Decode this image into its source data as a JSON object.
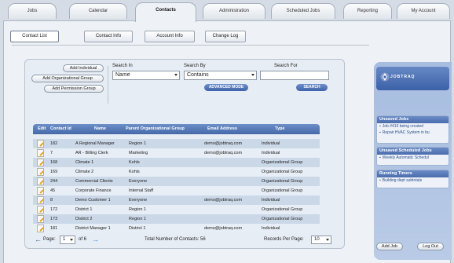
{
  "top_nav": {
    "tabs": [
      {
        "label": "Jobs",
        "active": false
      },
      {
        "label": "Calendar",
        "active": false
      },
      {
        "label": "Contacts",
        "active": true
      },
      {
        "label": "Administration",
        "active": false
      },
      {
        "label": "Scheduled Jobs",
        "active": false
      },
      {
        "label": "Reporting",
        "active": false
      },
      {
        "label": "My Account",
        "active": false
      }
    ]
  },
  "sub_tabs": [
    {
      "label": "Contact List",
      "active": true
    },
    {
      "label": "Contact Info",
      "active": false
    },
    {
      "label": "Account Info",
      "active": false
    },
    {
      "label": "Change Log",
      "active": false
    }
  ],
  "actions": {
    "add_individual": "Add Individual",
    "add_organizational_group": "Add Organizational Group",
    "add_permission_group": "Add Permission Group"
  },
  "search": {
    "search_in_label": "Search In",
    "search_in_value": "Name",
    "search_by_label": "Search By",
    "search_by_value": "Contains",
    "search_for_label": "Search For",
    "search_for_value": "",
    "advanced_mode_label": "ADVANCED MODE",
    "search_button_label": "SEARCH"
  },
  "table": {
    "columns": [
      "Edit",
      "Contact Id",
      "Name",
      "Parent Organizational Group",
      "Email Address",
      "Type"
    ],
    "rows": [
      {
        "id": "182",
        "name": "A Regional Manager",
        "parent": "Region 1",
        "email": "demo@jobtraq.com",
        "type": "Individual"
      },
      {
        "id": "7",
        "name": "AR - Billing Clerk",
        "parent": "Marketing",
        "email": "demo@jobtraq.com",
        "type": "Individual"
      },
      {
        "id": "168",
        "name": "Climate 1",
        "parent": "Kohls",
        "email": "",
        "type": "Organizational Group"
      },
      {
        "id": "169",
        "name": "Climate 2",
        "parent": "Kohls",
        "email": "",
        "type": "Organizational Group"
      },
      {
        "id": "244",
        "name": "Commercial Clients",
        "parent": "Everyone",
        "email": "",
        "type": "Organizational Group"
      },
      {
        "id": "45",
        "name": "Corporate Finance",
        "parent": "Internal Staff",
        "email": "",
        "type": "Organizational Group"
      },
      {
        "id": "8",
        "name": "Demo Customer 1",
        "parent": "Everyone",
        "email": "demo@jobtraq.com",
        "type": "Individual"
      },
      {
        "id": "172",
        "name": "District 1",
        "parent": "Region 1",
        "email": "",
        "type": "Organizational Group"
      },
      {
        "id": "173",
        "name": "District 2",
        "parent": "Region 1",
        "email": "",
        "type": "Organizational Group"
      },
      {
        "id": "181",
        "name": "District Manager 1",
        "parent": "District 1",
        "email": "demo@jobtraq.com",
        "type": "Individual"
      }
    ]
  },
  "pager": {
    "page_label": "Page:",
    "page_value": "1",
    "of_label": "of 6",
    "total_label": "Total Number of Contacts: 56",
    "per_page_label": "Records Per Page:",
    "per_page_value": "10"
  },
  "sidebar": {
    "logo_text": "JOBTRAQ",
    "sections": [
      {
        "title": "Unsaved Jobs",
        "items": [
          "Job #416 being created",
          "Repair HVAC System in bu"
        ]
      },
      {
        "title": "Unsaved Scheduled Jobs",
        "items": [
          "Weekly Automatic Schedul"
        ]
      },
      {
        "title": "Running Timers",
        "items": [
          "Building dept subtotals"
        ]
      }
    ],
    "add_job_label": "Add Job",
    "log_out_label": "Log Out"
  },
  "colors": {
    "header_blue": "#4568a9",
    "row_odd": "#cbd8e8",
    "row_even": "#e8eef6",
    "sidebar_bg": "#a7bde0",
    "arrow_forward": "#2e8de8"
  }
}
